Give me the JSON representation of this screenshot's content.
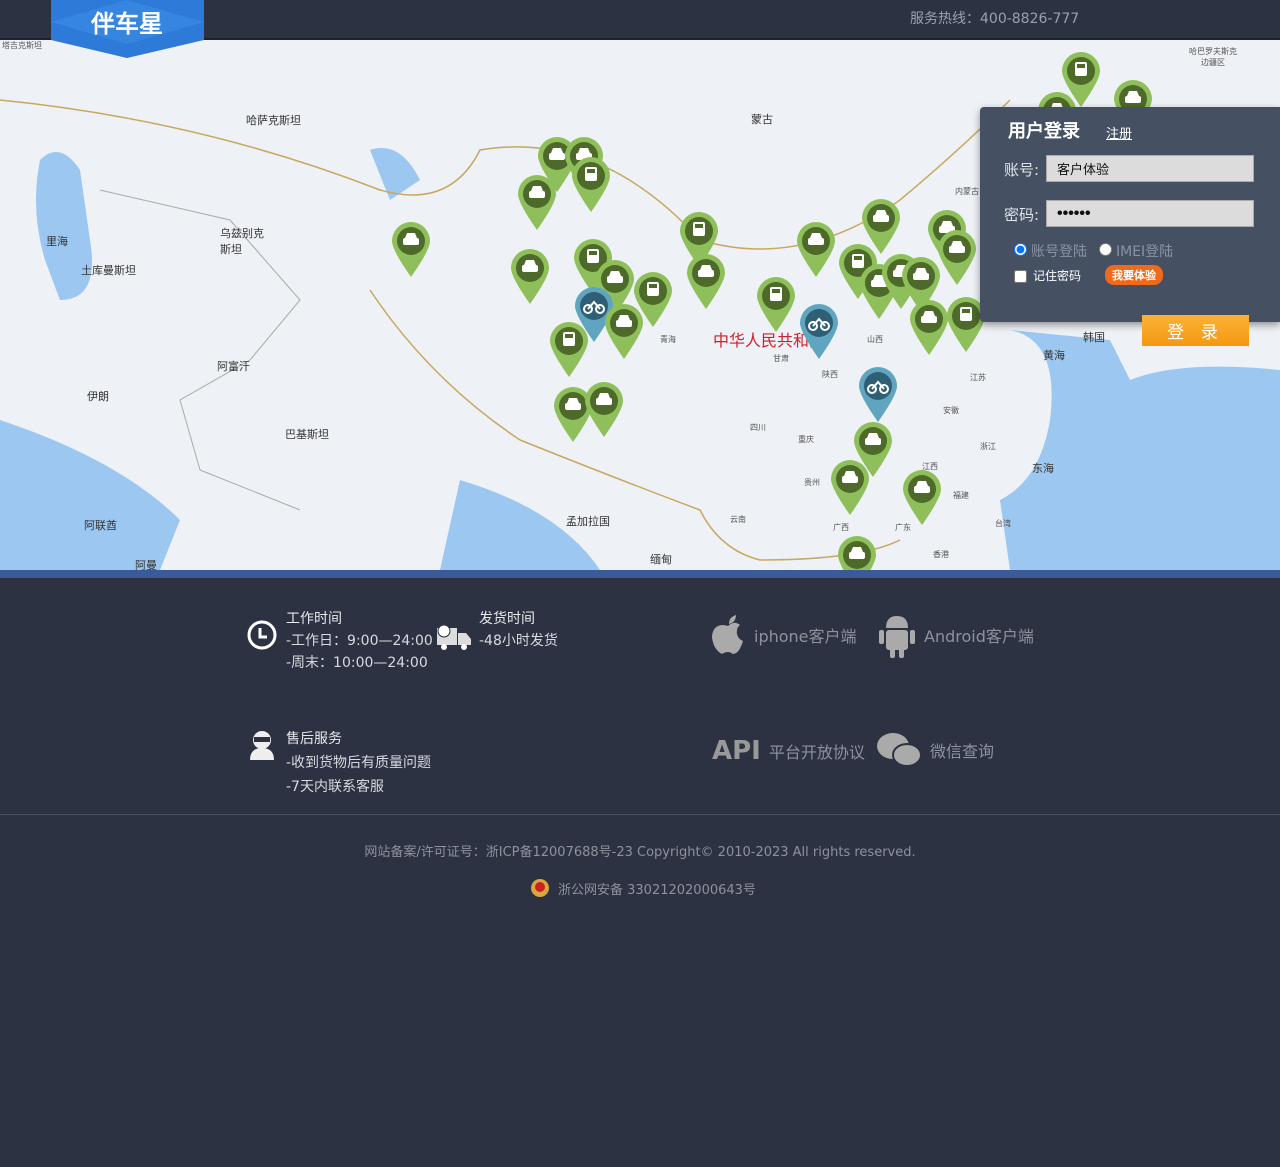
{
  "header": {
    "logo_text": "伴车星",
    "hotline": "服务热线：400-8826-777"
  },
  "map": {
    "labels": [
      "哈萨克斯坦",
      "蒙古",
      "乌兹别克斯坦",
      "里海",
      "土库曼斯坦",
      "阿富汗",
      "伊朗",
      "巴基斯坦",
      "阿联酋",
      "阿曼",
      "孟加拉国",
      "缅甸",
      "中华人民共和国",
      "韩国",
      "黄海",
      "东海",
      "青海",
      "甘肃",
      "陕西",
      "山西",
      "四川",
      "重庆",
      "贵州",
      "云南",
      "广西",
      "广东",
      "福建",
      "浙江",
      "江苏",
      "安徽",
      "江西",
      "台湾",
      "香港",
      "哈巴罗夫斯克边疆区",
      "内蒙古",
      "塔吉克斯坦"
    ]
  },
  "login": {
    "title": "用户登录",
    "register": "注册",
    "account_label": "账号:",
    "account_value": "客户体验",
    "password_label": "密码:",
    "password_value": "••••••",
    "mode_account": "账号登陆",
    "mode_imei": "IMEI登陆",
    "remember": "记住密码",
    "try": "我要体验",
    "submit": "登 录"
  },
  "footer": {
    "work": {
      "title": "工作时间",
      "l1": "-工作日：9:00—24:00",
      "l2": "-周末：10:00—24:00"
    },
    "ship": {
      "title": "发货时间",
      "l1": "-48小时发货"
    },
    "after": {
      "title": "售后服务",
      "l1": "-收到货物后有质量问题",
      "l2": "-7天内联系客服"
    },
    "apps": {
      "iphone": "iphone客户端",
      "android": "Android客户端",
      "api_logo": "API",
      "api": "平台开放协议",
      "wechat": "微信查询"
    },
    "copyright": "网站备案/许可证号：浙ICP备12007688号-23 Copyright© 2010-2023 All rights reserved.",
    "beian": "浙公网安备 33021202000643号"
  }
}
